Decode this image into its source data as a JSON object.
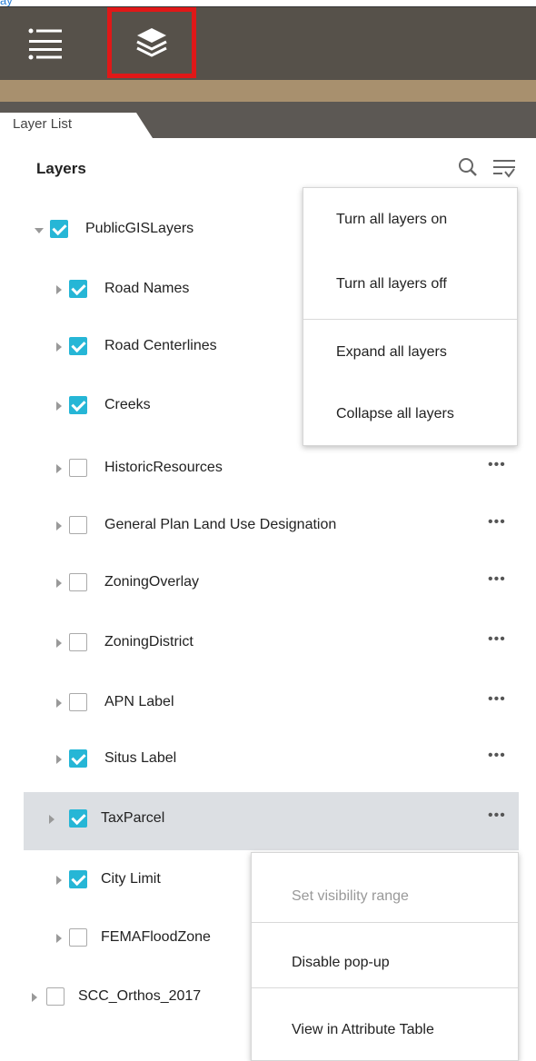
{
  "top_strip": {
    "text": "ay"
  },
  "toolbar": {
    "layer_list_icon": "bulleted-list-icon",
    "layers_icon": "stacked-layers-icon"
  },
  "panel": {
    "tab_label": "Layer List",
    "title": "Layers",
    "search_icon": "search-icon",
    "menu_icon": "filter-menu-icon"
  },
  "layers": [
    {
      "name": "PublicGISLayers",
      "checked": true,
      "expanded": true,
      "level": 0
    },
    {
      "name": "Road Names",
      "checked": true,
      "level": 1
    },
    {
      "name": "Road Centerlines",
      "checked": true,
      "level": 1
    },
    {
      "name": "Creeks",
      "checked": true,
      "level": 1
    },
    {
      "name": "HistoricResources",
      "checked": false,
      "level": 1,
      "more": "•••"
    },
    {
      "name": "General Plan Land Use Designation",
      "checked": false,
      "level": 1,
      "more": "•••"
    },
    {
      "name": "ZoningOverlay",
      "checked": false,
      "level": 1,
      "more": "•••"
    },
    {
      "name": "ZoningDistrict",
      "checked": false,
      "level": 1,
      "more": "•••"
    },
    {
      "name": "APN Label",
      "checked": false,
      "level": 1,
      "more": "•••"
    },
    {
      "name": "Situs Label",
      "checked": true,
      "level": 1,
      "more": "•••"
    },
    {
      "name": "TaxParcel",
      "checked": true,
      "level": 1,
      "more": "•••",
      "highlighted": true
    },
    {
      "name": "City Limit",
      "checked": true,
      "level": 1
    },
    {
      "name": "FEMAFloodZone",
      "checked": false,
      "level": 1
    },
    {
      "name": "SCC_Orthos_2017",
      "checked": false,
      "level": 0
    }
  ],
  "global_menu": {
    "items": [
      "Turn all layers on",
      "Turn all layers off",
      "Expand all layers",
      "Collapse all layers"
    ]
  },
  "layer_menu": {
    "items": [
      "Set visibility range",
      "Disable pop-up",
      "View in Attribute Table"
    ],
    "disabled_index": 0
  },
  "colors": {
    "toolbar": "#56514a",
    "accent_bar": "#a8906e",
    "checkbox": "#26b6d6",
    "selection_outline": "#e01818",
    "highlight_row": "#dcdfe3"
  }
}
